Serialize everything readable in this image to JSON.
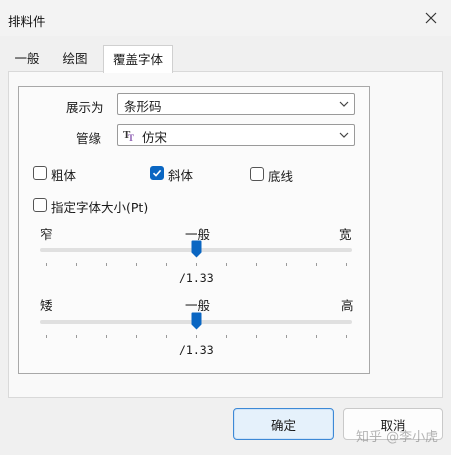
{
  "window": {
    "title": "排料件"
  },
  "tabs": [
    {
      "label": "一般",
      "active": false
    },
    {
      "label": "绘图",
      "active": false
    },
    {
      "label": "覆盖字体",
      "active": true
    }
  ],
  "form": {
    "display_as_label": "展示为",
    "display_as_value": "条形码",
    "pipeline_label": "管缘",
    "font_value": "仿宋",
    "font_icon": "truetype-icon",
    "bold": {
      "label": "粗体",
      "checked": false
    },
    "italic": {
      "label": "斜体",
      "checked": true
    },
    "underline": {
      "label": "底线",
      "checked": false
    },
    "specify_size": {
      "label": "指定字体大小(Pt)",
      "checked": false
    },
    "width_slider": {
      "left_label": "窄",
      "mid_label": "一般",
      "right_label": "宽",
      "value_text": "/1.33",
      "level": 0.5
    },
    "height_slider": {
      "left_label": "矮",
      "mid_label": "一般",
      "right_label": "高",
      "value_text": "/1.33",
      "level": 0.5
    }
  },
  "buttons": {
    "ok_label": "确定",
    "cancel_label": "取消"
  },
  "watermark": "知乎 @李小虎",
  "colors": {
    "accent": "#0a66c2",
    "title_bg": "#f3f3f3"
  }
}
